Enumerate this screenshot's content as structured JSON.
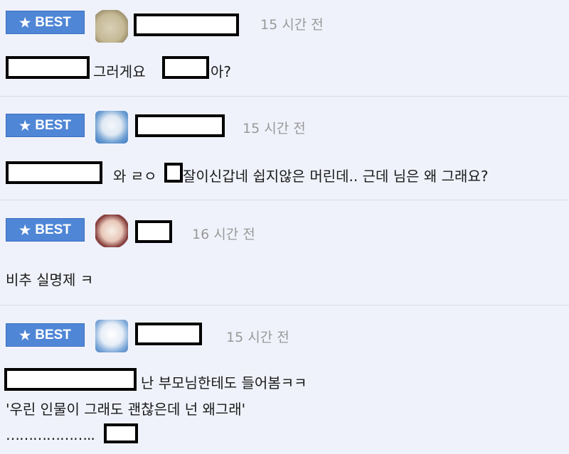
{
  "badge": {
    "label": "BEST",
    "icon": "star-icon",
    "color": "#4f86d6"
  },
  "comments": [
    {
      "time": "15 시간 전",
      "text_a": "그러게요",
      "text_b": "아?"
    },
    {
      "time": "15 시간 전",
      "text_a": "와 ㄹㅇ",
      "text_b": "잘이신갑네 쉽지않은 머린데.. 근데 님은 왜 그래요?"
    },
    {
      "time": "16 시간 전",
      "text_a": "비추 실명제 ㅋ"
    },
    {
      "time": "15 시간 전",
      "text_a": "난 부모님한테도 들어봄ㅋㅋ",
      "text_b": "'우린 인물이 그래도 괜찮은데 넌 왜그래'",
      "text_c": "……………….."
    }
  ]
}
